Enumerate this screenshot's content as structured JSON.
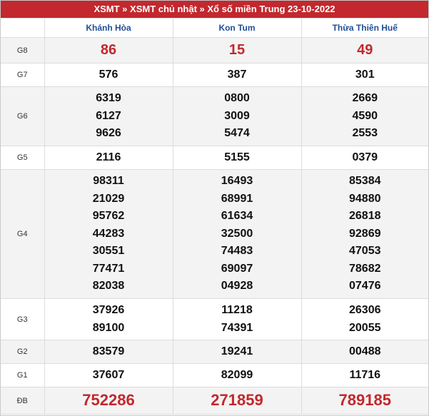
{
  "header": {
    "title": "XSMT » XSMT chủ nhật » Xổ số miền Trung 23-10-2022",
    "colors": {
      "bar": "#c2282d",
      "province_text": "#1f4e96",
      "special_numbers": "#c2282d"
    }
  },
  "provinces": [
    "Khánh Hòa",
    "Kon Tum",
    "Thừa Thiên Huế"
  ],
  "prizes": [
    {
      "label": "G8",
      "values": [
        [
          "86"
        ],
        [
          "15"
        ],
        [
          "49"
        ]
      ]
    },
    {
      "label": "G7",
      "values": [
        [
          "576"
        ],
        [
          "387"
        ],
        [
          "301"
        ]
      ]
    },
    {
      "label": "G6",
      "values": [
        [
          "6319",
          "6127",
          "9626"
        ],
        [
          "0800",
          "3009",
          "5474"
        ],
        [
          "2669",
          "4590",
          "2553"
        ]
      ]
    },
    {
      "label": "G5",
      "values": [
        [
          "2116"
        ],
        [
          "5155"
        ],
        [
          "0379"
        ]
      ]
    },
    {
      "label": "G4",
      "values": [
        [
          "98311",
          "21029",
          "95762",
          "44283",
          "30551",
          "77471",
          "82038"
        ],
        [
          "16493",
          "68991",
          "61634",
          "32500",
          "74483",
          "69097",
          "04928"
        ],
        [
          "85384",
          "94880",
          "26818",
          "92869",
          "47053",
          "78682",
          "07476"
        ]
      ]
    },
    {
      "label": "G3",
      "values": [
        [
          "37926",
          "89100"
        ],
        [
          "11218",
          "74391"
        ],
        [
          "26306",
          "20055"
        ]
      ]
    },
    {
      "label": "G2",
      "values": [
        [
          "83579"
        ],
        [
          "19241"
        ],
        [
          "00488"
        ]
      ]
    },
    {
      "label": "G1",
      "values": [
        [
          "37607"
        ],
        [
          "82099"
        ],
        [
          "11716"
        ]
      ]
    },
    {
      "label": "ĐB",
      "values": [
        [
          "752286"
        ],
        [
          "271859"
        ],
        [
          "789185"
        ]
      ]
    }
  ]
}
